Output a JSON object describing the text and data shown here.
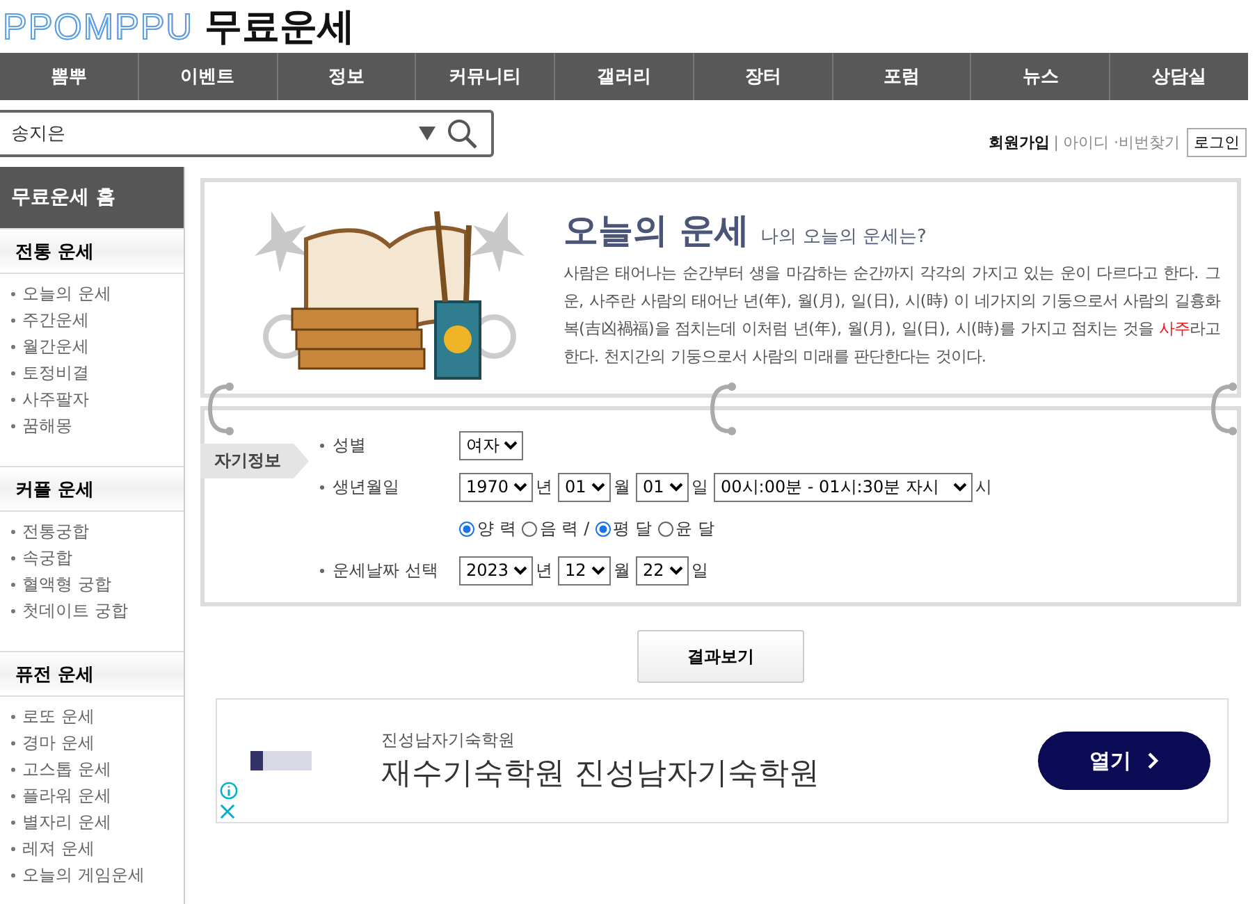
{
  "header": {
    "logo": "PPOMPPU",
    "title": "무료운세"
  },
  "nav": [
    "뽐뿌",
    "이벤트",
    "정보",
    "커뮤니티",
    "갤러리",
    "장터",
    "포럼",
    "뉴스",
    "상담실"
  ],
  "search": {
    "value": "송지은"
  },
  "account": {
    "signup": "회원가입",
    "separator": "|",
    "find": "아이디 ·비번찾기",
    "login": "로그인"
  },
  "sidebar": {
    "home": "무료운세 홈",
    "sections": [
      {
        "title": "전통 운세",
        "items": [
          "오늘의 운세",
          "주간운세",
          "월간운세",
          "토정비결",
          "사주팔자",
          "꿈해몽"
        ]
      },
      {
        "title": "커플 운세",
        "items": [
          "전통궁합",
          "속궁합",
          "혈액형 궁합",
          "첫데이트 궁합"
        ]
      },
      {
        "title": "퓨전 운세",
        "items": [
          "로또 운세",
          "경마 운세",
          "고스톱 운세",
          "플라워 운세",
          "별자리 운세",
          "레져 운세",
          "오늘의 게임운세"
        ]
      }
    ]
  },
  "intro": {
    "title": "오늘의 운세",
    "subtitle": "나의 오늘의 운세는?",
    "body": [
      {
        "kind": "plain",
        "text": "사람은 태어나는 순간부터 생을 마감하는 순간까지 각각의 가지고 있는 운이 다르다고 한다. 그 운, 사주란 사람의 태어난 년(年), 월(月), 일(日), 시(時) 이 네가지의 기둥으로서 사람의 길흉화복(吉凶禍福)을 점치는데 이처럼 년(年), 월(月), 일(日), 시(時)를 가지고 점치는 것을 "
      },
      {
        "kind": "highlight",
        "text": "사주"
      },
      {
        "kind": "plain",
        "text": "라고한다. 천지간의 기둥으로서 사람의 미래를 판단한다는 것이다."
      }
    ]
  },
  "form": {
    "tab": "자기정보",
    "rows": [
      {
        "label": "성별",
        "fields": [
          {
            "kind": "select",
            "value": "여자"
          }
        ]
      },
      {
        "label": "생년월일",
        "fields": [
          {
            "kind": "select",
            "value": "1970"
          },
          {
            "kind": "text",
            "value": "년"
          },
          {
            "kind": "select",
            "value": "01"
          },
          {
            "kind": "text",
            "value": "월"
          },
          {
            "kind": "select",
            "value": "01"
          },
          {
            "kind": "text",
            "value": "일"
          },
          {
            "kind": "wide-select",
            "value": "00시:00분 - 01시:30분 자시"
          },
          {
            "kind": "text",
            "value": "시"
          }
        ]
      },
      {
        "fields": [
          {
            "kind": "radio",
            "value": "양 력",
            "selected": true
          },
          {
            "kind": "radio",
            "value": "음 력",
            "selected": false
          },
          {
            "kind": "text",
            "value": "/"
          },
          {
            "kind": "radio",
            "value": "평 달",
            "selected": true
          },
          {
            "kind": "radio",
            "value": "윤 달",
            "selected": false
          }
        ]
      },
      {
        "label": "운세날짜 선택",
        "fields": [
          {
            "kind": "select",
            "value": "2023"
          },
          {
            "kind": "text",
            "value": "년"
          },
          {
            "kind": "select",
            "value": "12"
          },
          {
            "kind": "text",
            "value": "월"
          },
          {
            "kind": "select",
            "value": "22"
          },
          {
            "kind": "text",
            "value": "일"
          }
        ]
      }
    ],
    "submit": "결과보기"
  },
  "ad": {
    "advertiser": "진성남자기숙학원",
    "headline": "재수기숙학원 진성남자기숙학원",
    "cta": "열기"
  }
}
